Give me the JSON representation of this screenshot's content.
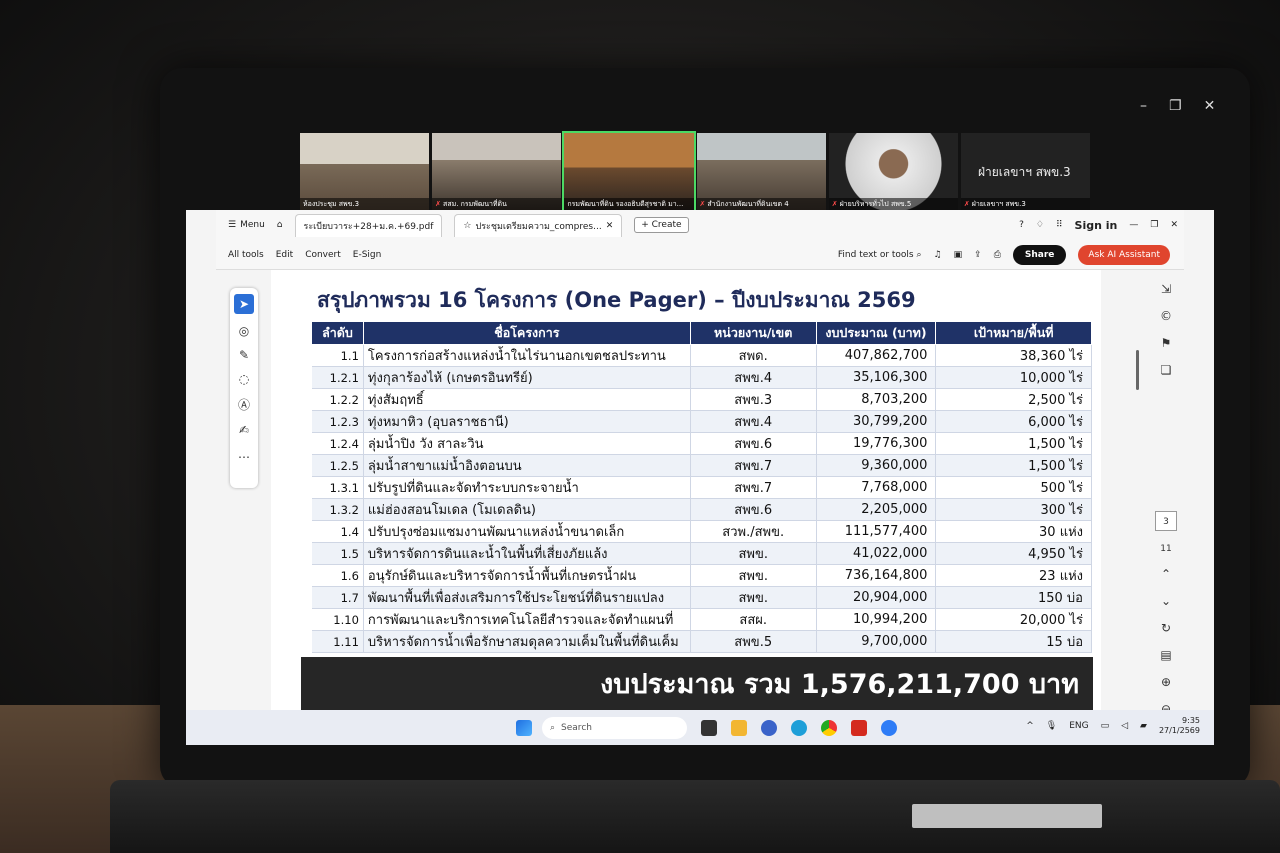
{
  "window_controls": [
    "–",
    "❐",
    "✕"
  ],
  "meeting": {
    "tiles": [
      {
        "label": "ห้องประชุม สพข.3",
        "muted": false,
        "active": false
      },
      {
        "label": "สสม. กรมพัฒนาที่ดิน",
        "muted": true,
        "active": false
      },
      {
        "label": "กรมพัฒนาที่ดิน รองอธิบดีสุรชาติ มา...",
        "muted": false,
        "active": true
      },
      {
        "label": "สำนักงานพัฒนาที่ดินเขต 4",
        "muted": true,
        "active": false
      },
      {
        "label": "ฝ่ายบริหารทั่วไป สพข.5",
        "muted": true,
        "active": false
      },
      {
        "label": "ฝ่ายเลขาฯ สพข.3",
        "muted": true,
        "active": false
      }
    ],
    "speaker_name": "ฝ่ายเลขาฯ สพข.3"
  },
  "acrobat": {
    "menu_label": "Menu",
    "tabs": [
      {
        "label": "ระเบียบวาระ+28+ม.ค.+69.pdf"
      },
      {
        "label": "ประชุมเตรียมความ_compres..."
      }
    ],
    "create_label": "+ Create",
    "sign_in": "Sign in",
    "tools": [
      "All tools",
      "Edit",
      "Convert",
      "E-Sign"
    ],
    "find_label": "Find text or tools",
    "share_label": "Share",
    "ai_label": "Ask AI Assistant",
    "page_number": "3",
    "page_total": "11"
  },
  "document": {
    "title": "สรุปภาพรวม 16 โครงการ (One Pager) – ปีงบประมาณ 2569",
    "columns": [
      "ลำดับ",
      "ชื่อโครงการ",
      "หน่วยงาน/เขต",
      "งบประมาณ (บาท)",
      "เป้าหมาย/พื้นที่"
    ],
    "rows": [
      [
        "1.1",
        "โครงการก่อสร้างแหล่งน้ำในไร่นานอกเขตชลประทาน",
        "สพด.",
        "407,862,700",
        "38,360 ไร่"
      ],
      [
        "1.2.1",
        "ทุ่งกุลาร้องไห้ (เกษตรอินทรีย์)",
        "สพข.4",
        "35,106,300",
        "10,000 ไร่"
      ],
      [
        "1.2.2",
        "ทุ่งสัมฤทธิ์",
        "สพข.3",
        "8,703,200",
        "2,500 ไร่"
      ],
      [
        "1.2.3",
        "ทุ่งหมาหิว (อุบลราชธานี)",
        "สพข.4",
        "30,799,200",
        "6,000 ไร่"
      ],
      [
        "1.2.4",
        "ลุ่มน้ำปิง วัง สาละวิน",
        "สพข.6",
        "19,776,300",
        "1,500 ไร่"
      ],
      [
        "1.2.5",
        "ลุ่มน้ำสาขาแม่น้ำอิงตอนบน",
        "สพข.7",
        "9,360,000",
        "1,500 ไร่"
      ],
      [
        "1.3.1",
        "ปรับรูปที่ดินและจัดทำระบบกระจายน้ำ",
        "สพข.7",
        "7,768,000",
        "500 ไร่"
      ],
      [
        "1.3.2",
        "แม่ฮ่องสอนโมเดล (โมเดลดิน)",
        "สพข.6",
        "2,205,000",
        "300 ไร่"
      ],
      [
        "1.4",
        "ปรับปรุงซ่อมแซมงานพัฒนาแหล่งน้ำขนาดเล็ก",
        "สวพ./สพข.",
        "111,577,400",
        "30 แห่ง"
      ],
      [
        "1.5",
        "บริหารจัดการดินและน้ำในพื้นที่เสี่ยงภัยแล้ง",
        "สพข.",
        "41,022,000",
        "4,950 ไร่"
      ],
      [
        "1.6",
        "อนุรักษ์ดินและบริหารจัดการน้ำพื้นที่เกษตรน้ำฝน",
        "สพข.",
        "736,164,800",
        "23 แห่ง"
      ],
      [
        "1.7",
        "พัฒนาพื้นที่เพื่อส่งเสริมการใช้ประโยชน์ที่ดินรายแปลง",
        "สพข.",
        "20,904,000",
        "150 บ่อ"
      ],
      [
        "1.10",
        "การพัฒนาและบริการเทคโนโลยีสำรวจและจัดทำแผนที่",
        "สสผ.",
        "10,994,200",
        "20,000 ไร่"
      ],
      [
        "1.11",
        "บริหารจัดการน้ำเพื่อรักษาสมดุลความเค็มในพื้นที่ดินเค็ม",
        "สพข.5",
        "9,700,000",
        "15 บ่อ"
      ]
    ],
    "total_label": "งบประมาณ รวม 1,576,211,700 บาท"
  },
  "taskbar": {
    "search_placeholder": "Search",
    "lang": "ENG",
    "time": "9:35",
    "date": "27/1/2569"
  }
}
